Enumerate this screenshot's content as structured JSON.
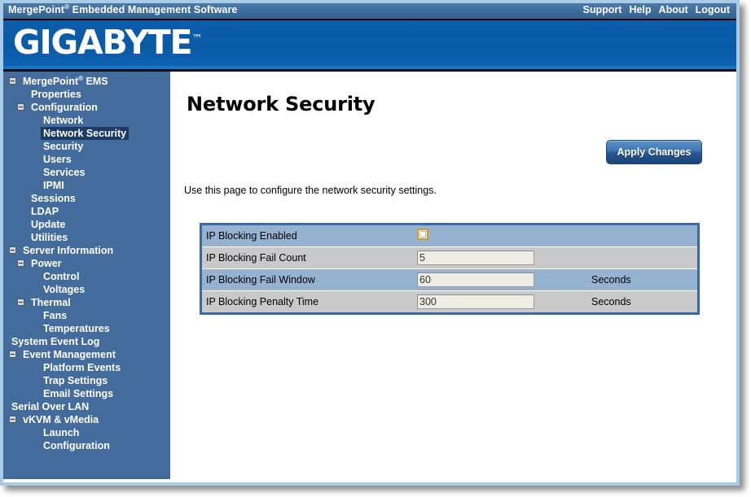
{
  "window": {
    "titlebar": {
      "product": "MergePoint",
      "product_sup": "®",
      "product_suffix": " Embedded Management Software",
      "links": [
        "Support",
        "Help",
        "About",
        "Logout"
      ]
    },
    "banner": {
      "logo": "GIGABYTE",
      "trademark": "™"
    }
  },
  "sidebar": {
    "items": [
      {
        "label": "MergePoint",
        "sup": "®",
        "suffix": " EMS",
        "indent": 0,
        "expander": true,
        "selected": false
      },
      {
        "label": "Properties",
        "indent": 1,
        "expander": false,
        "selected": false
      },
      {
        "label": "Configuration",
        "indent": 1,
        "expander": true,
        "selected": false
      },
      {
        "label": "Network",
        "indent": 2,
        "expander": false,
        "selected": false
      },
      {
        "label": "Network Security",
        "indent": 2,
        "expander": false,
        "selected": true
      },
      {
        "label": "Security",
        "indent": 2,
        "expander": false,
        "selected": false
      },
      {
        "label": "Users",
        "indent": 2,
        "expander": false,
        "selected": false
      },
      {
        "label": "Services",
        "indent": 2,
        "expander": false,
        "selected": false
      },
      {
        "label": "IPMI",
        "indent": 2,
        "expander": false,
        "selected": false
      },
      {
        "label": "Sessions",
        "indent": 1,
        "expander": false,
        "selected": false
      },
      {
        "label": "LDAP",
        "indent": 1,
        "expander": false,
        "selected": false
      },
      {
        "label": "Update",
        "indent": 1,
        "expander": false,
        "selected": false
      },
      {
        "label": "Utilities",
        "indent": 1,
        "expander": false,
        "selected": false
      },
      {
        "label": "Server Information",
        "indent": 0,
        "expander": true,
        "selected": false
      },
      {
        "label": "Power",
        "indent": 1,
        "expander": true,
        "selected": false
      },
      {
        "label": "Control",
        "indent": 2,
        "expander": false,
        "selected": false
      },
      {
        "label": "Voltages",
        "indent": 2,
        "expander": false,
        "selected": false
      },
      {
        "label": "Thermal",
        "indent": 1,
        "expander": true,
        "selected": false
      },
      {
        "label": "Fans",
        "indent": 2,
        "expander": false,
        "selected": false
      },
      {
        "label": "Temperatures",
        "indent": 2,
        "expander": false,
        "selected": false
      },
      {
        "label": "System Event Log",
        "indent": 0,
        "expander": false,
        "selected": false
      },
      {
        "label": "Event Management",
        "indent": 0,
        "expander": true,
        "selected": false
      },
      {
        "label": "Platform Events",
        "indent": 2,
        "expander": false,
        "selected": false
      },
      {
        "label": "Trap Settings",
        "indent": 2,
        "expander": false,
        "selected": false
      },
      {
        "label": "Email Settings",
        "indent": 2,
        "expander": false,
        "selected": false
      },
      {
        "label": "Serial Over LAN",
        "indent": 0,
        "expander": false,
        "selected": false
      },
      {
        "label": "vKVM & vMedia",
        "indent": 0,
        "expander": true,
        "selected": false
      },
      {
        "label": "Launch",
        "indent": 2,
        "expander": false,
        "selected": false
      },
      {
        "label": "Configuration",
        "indent": 2,
        "expander": false,
        "selected": false
      }
    ]
  },
  "main": {
    "title": "Network Security",
    "apply_label": "Apply Changes",
    "description": "Use this page to configure the network security settings.",
    "settings": [
      {
        "label": "IP Blocking Enabled",
        "control": "checkbox",
        "checked": false,
        "value": "",
        "unit": ""
      },
      {
        "label": "IP Blocking Fail Count",
        "control": "text",
        "value": "5",
        "unit": ""
      },
      {
        "label": "IP Blocking Fail Window",
        "control": "text",
        "value": "60",
        "unit": "Seconds"
      },
      {
        "label": "IP Blocking Penalty Time",
        "control": "text",
        "value": "300",
        "unit": "Seconds"
      }
    ]
  },
  "colors": {
    "titlebar": "#3f6e9c",
    "banner": "#0a5ba8",
    "sidebar": "#436c9c",
    "selected_item": "#1c3a63",
    "table_border": "#3a6ba0",
    "row_odd": "#95b2d0",
    "row_even": "#c9c9c9",
    "accent_button": "#27578f",
    "checkbox_border": "#d69a22"
  }
}
